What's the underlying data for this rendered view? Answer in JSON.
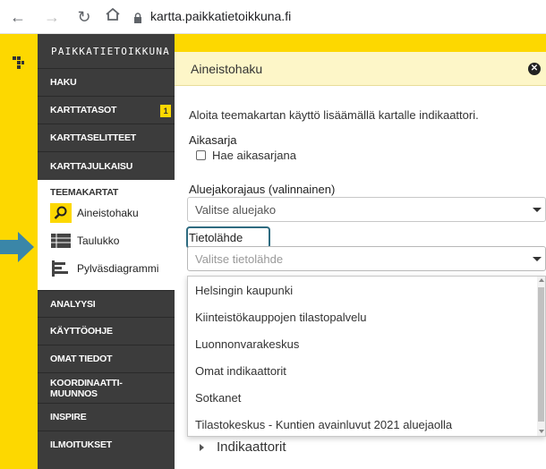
{
  "browser": {
    "url": "kartta.paikkatietoikkuna.fi"
  },
  "sidebar": {
    "brand": "PAIKKATIETOIKKUNA",
    "items_top": [
      {
        "label": "HAKU"
      },
      {
        "label": "KARTTATASOT",
        "badge": "1"
      },
      {
        "label": "KARTTASELITTEET"
      },
      {
        "label": "KARTTAJULKAISU"
      }
    ],
    "active": {
      "title": "TEEMAKARTAT",
      "subitems": [
        {
          "label": "Aineistohaku",
          "icon": "search-icon"
        },
        {
          "label": "Taulukko",
          "icon": "table-icon"
        },
        {
          "label": "Pylväsdiagrammi",
          "icon": "bar-chart-icon"
        }
      ]
    },
    "items_bottom": [
      {
        "label": "ANALYYSI"
      },
      {
        "label": "KÄYTTÖOHJE"
      },
      {
        "label": "OMAT TIEDOT"
      },
      {
        "label": "KOORDINAATTI-MUUNNOS"
      },
      {
        "label": "INSPIRE"
      },
      {
        "label": "ILMOITUKSET"
      }
    ]
  },
  "panel": {
    "title": "Aineistohaku",
    "intro": "Aloita teemakartan käyttö lisäämällä kartalle indikaattori.",
    "aikasarja_label": "Aikasarja",
    "aikasarja_checkbox": "Hae aikasarjana",
    "aluejako_label": "Aluejakorajaus (valinnainen)",
    "aluejako_value": "Valitse aluejako",
    "tietolahde_label": "Tietolähde",
    "tietolahde_placeholder": "Valitse tietolähde",
    "dropdown_options": [
      "Helsingin kaupunki",
      "Kiinteistökauppojen tilastopalvelu",
      "Luonnonvarakeskus",
      "Omat indikaattorit",
      "Sotkanet",
      "Tilastokeskus - Kuntien avainluvut 2021 aluejaolla"
    ],
    "indicators_label": "Indikaattorit"
  },
  "colors": {
    "accent_yellow": "#fdd800",
    "sidebar_dark": "#3c3c3c",
    "highlight_border": "#2e6b80",
    "cue_arrow": "#3a86a8"
  }
}
